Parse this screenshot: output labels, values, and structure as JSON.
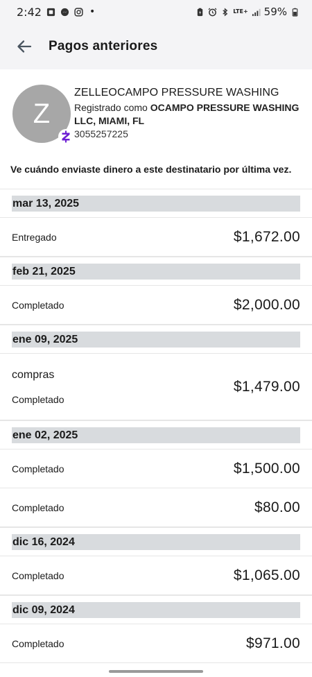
{
  "status_bar": {
    "time": "2:42",
    "dot": "•",
    "network": "LTE+",
    "battery": "59%"
  },
  "header": {
    "title": "Pagos anteriores",
    "back_icon": "arrow-left-icon"
  },
  "recipient": {
    "avatar_initial": "Z",
    "name": "ZELLEOCAMPO PRESSURE WASHING",
    "registered_prefix": "Registrado como ",
    "registered_name": "OCAMPO PRESSURE WASHING LLC, MIAMI, FL",
    "phone": "3055257225",
    "badge_letter": "Z",
    "badge_color": "#6d1ed4"
  },
  "intro": "Ve cuándo enviaste dinero a este destinatario por última vez.",
  "groups": [
    {
      "date": "mar 13, 2025",
      "transactions": [
        {
          "memo": "",
          "status": "Entregado",
          "amount": "$1,672.00"
        }
      ]
    },
    {
      "date": "feb 21, 2025",
      "transactions": [
        {
          "memo": "",
          "status": "Completado",
          "amount": "$2,000.00"
        }
      ]
    },
    {
      "date": "ene 09, 2025",
      "transactions": [
        {
          "memo": "compras",
          "status": "Completado",
          "amount": "$1,479.00"
        }
      ]
    },
    {
      "date": "ene 02, 2025",
      "transactions": [
        {
          "memo": "",
          "status": "Completado",
          "amount": "$1,500.00"
        },
        {
          "memo": "",
          "status": "Completado",
          "amount": "$80.00"
        }
      ]
    },
    {
      "date": "dic 16, 2024",
      "transactions": [
        {
          "memo": "",
          "status": "Completado",
          "amount": "$1,065.00"
        }
      ]
    },
    {
      "date": "dic 09, 2024",
      "transactions": [
        {
          "memo": "",
          "status": "Completado",
          "amount": "$971.00"
        }
      ]
    }
  ]
}
